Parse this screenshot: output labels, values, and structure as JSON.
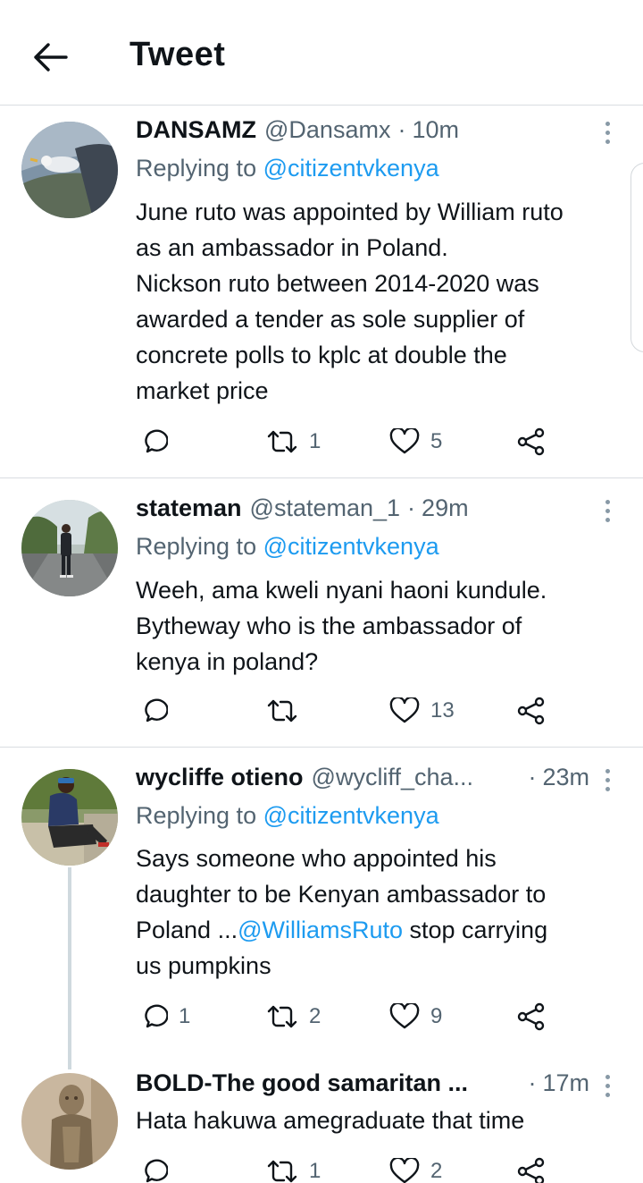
{
  "header": {
    "title": "Tweet",
    "back_icon": "arrow-left-icon"
  },
  "tweets": [
    {
      "name": "DANSAMZ",
      "handle": "@Dansamx",
      "separator": "·",
      "time": "10m",
      "replying_prefix": "Replying to ",
      "replying_to": "@citizentvkenya",
      "lines": [
        "June ruto was appointed by William ruto",
        "as an ambassador in Poland.",
        "Nickson ruto between 2014-2020 was",
        "awarded a tender as sole supplier of",
        "concrete polls to kplc at  double the",
        "market price"
      ],
      "replies": "",
      "retweets": "1",
      "likes": "5"
    },
    {
      "name": "stateman",
      "handle": "@stateman_1",
      "separator": "·",
      "time": "29m",
      "replying_prefix": "Replying to ",
      "replying_to": "@citizentvkenya",
      "lines": [
        "Weeh, ama kweli nyani haoni kundule.",
        "Bytheway who is  the ambassador of",
        "kenya in poland?"
      ],
      "replies": "",
      "retweets": "",
      "likes": "13"
    },
    {
      "name": "wycliffe otieno",
      "handle": "@wycliff_cha...",
      "separator": "·",
      "time": "23m",
      "replying_prefix": "Replying to ",
      "replying_to": "@citizentvkenya",
      "line1": "Says someone who appointed his",
      "line2": "daughter to be Kenyan ambassador to",
      "line3_before": "Poland ...",
      "line3_mention": "@WilliamsRuto",
      "line3_after": " stop carrying",
      "line4": "us pumpkins",
      "replies": "1",
      "retweets": "2",
      "likes": "9"
    },
    {
      "name": "BOLD-The good samaritan ...",
      "separator": "·",
      "time": "17m",
      "lines": [
        "Hata hakuwa amegraduate that time"
      ],
      "replies": "",
      "retweets": "1",
      "likes": "2"
    }
  ],
  "colors": {
    "text": "#0f1419",
    "secondary": "#536471",
    "mention": "#1d9bf0",
    "divider": "#d9dde1"
  },
  "icons": [
    "arrow-left-icon",
    "more-vertical-icon",
    "reply-icon",
    "retweet-icon",
    "heart-icon",
    "share-icon"
  ]
}
